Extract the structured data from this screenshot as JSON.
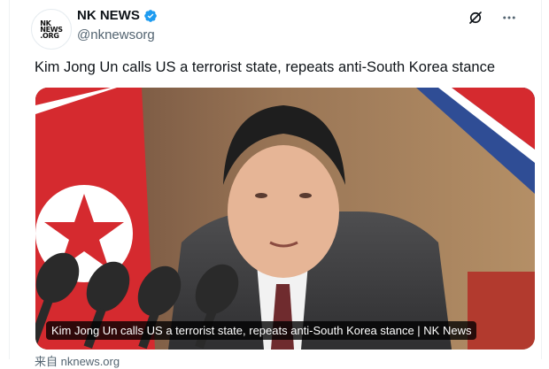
{
  "account": {
    "display_name": "NK NEWS",
    "handle": "@nknewsorg",
    "verified": true,
    "avatar_text": "NK\nNEWS\n.ORG"
  },
  "tweet": {
    "text": "Kim Jong Un calls US a terrorist state, repeats anti-South Korea stance"
  },
  "card": {
    "caption": "Kim Jong Un calls US a terrorist state, repeats anti-South Korea stance | NK News",
    "source": "来自 nknews.org"
  },
  "icons": {
    "verified": "verified-badge-icon",
    "grok": "grok-icon",
    "more": "more-horizontal-icon"
  },
  "colors": {
    "verified_blue": "#1d9bf0",
    "text_primary": "#0f1419",
    "text_secondary": "#536471"
  }
}
